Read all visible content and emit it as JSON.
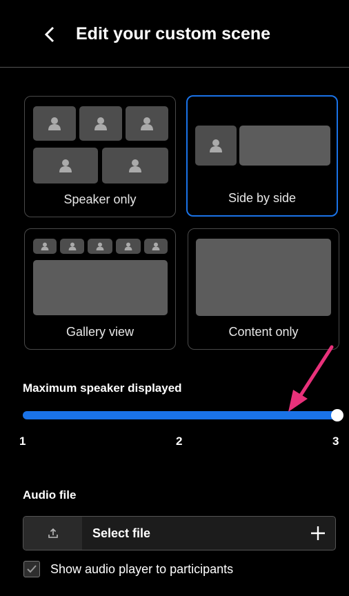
{
  "header": {
    "back_icon": "chevron-left-icon",
    "title": "Edit your custom scene"
  },
  "layouts": [
    {
      "label": "Speaker only",
      "selected": false
    },
    {
      "label": "Side by side",
      "selected": true
    },
    {
      "label": "Gallery view",
      "selected": false
    },
    {
      "label": "Content only",
      "selected": false
    }
  ],
  "slider": {
    "label": "Maximum speaker displayed",
    "min": 1,
    "max": 3,
    "value": 3,
    "ticks": [
      "1",
      "2",
      "3"
    ]
  },
  "audio": {
    "label": "Audio file",
    "select_text": "Select file",
    "upload_icon": "upload-icon",
    "add_icon": "plus-icon",
    "checkbox_label": "Show audio player to participants",
    "checkbox_checked": true
  },
  "colors": {
    "accent": "#1a73e8",
    "annotation_arrow": "#e8317a",
    "background": "#000000"
  }
}
